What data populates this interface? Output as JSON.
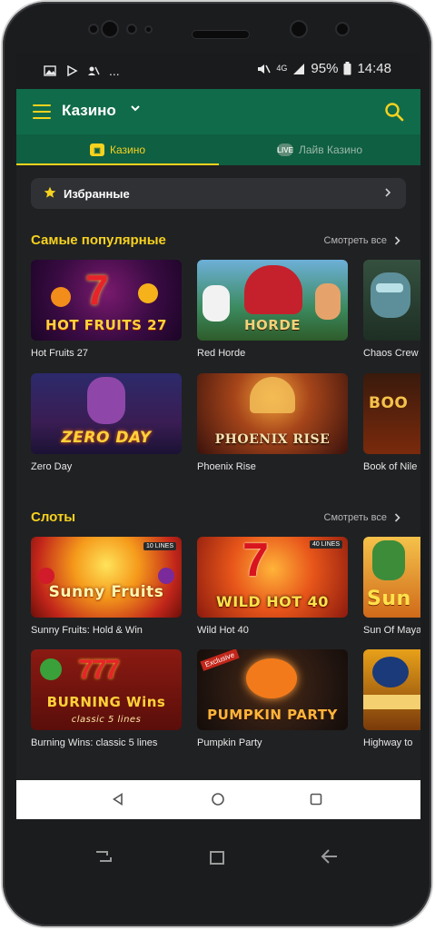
{
  "status": {
    "battery": "95%",
    "time": "14:48",
    "network": "4G",
    "dots": "..."
  },
  "appbar": {
    "title": "Казино"
  },
  "tabs": [
    {
      "label": "Казино",
      "icon": "casino-icon"
    },
    {
      "label": "Лайв Казино",
      "icon": "live-icon",
      "badge": "LIVE"
    }
  ],
  "favorites": {
    "label": "Избранные"
  },
  "sections": {
    "popular": {
      "title": "Самые популярные",
      "see_all": "Смотреть все",
      "games": [
        {
          "name": "Hot Fruits 27",
          "art": "HOT FRUITS 27"
        },
        {
          "name": "Red Horde",
          "art": "HORDE"
        },
        {
          "name": "Chaos Crew",
          "art": ""
        },
        {
          "name": "Zero Day",
          "art": "ZERO DAY"
        },
        {
          "name": "Phoenix Rise",
          "art": "PHOENIX RISE"
        },
        {
          "name": "Book of Nile",
          "art": "BOO"
        }
      ]
    },
    "slots": {
      "title": "Слоты",
      "see_all": "Смотреть все",
      "games": [
        {
          "name": "Sunny Fruits: Hold & Win",
          "art": "Sunny Fruits",
          "badge": "10 LINES"
        },
        {
          "name": "Wild Hot 40",
          "art": "WILD HOT 40",
          "badge": "40 LINES"
        },
        {
          "name": "Sun Of Maya",
          "art": "Sun"
        },
        {
          "name": "Burning Wins: classic 5 lines",
          "art": "BURNING Wins",
          "sub": "classic 5 lines"
        },
        {
          "name": "Pumpkin Party",
          "art": "PUMPKIN PARTY",
          "badge": "Exclusive"
        },
        {
          "name": "Highway to",
          "art": ""
        }
      ]
    }
  },
  "colors": {
    "brand_green": "#106b4a",
    "accent_yellow": "#f7d21e",
    "background": "#202123"
  }
}
